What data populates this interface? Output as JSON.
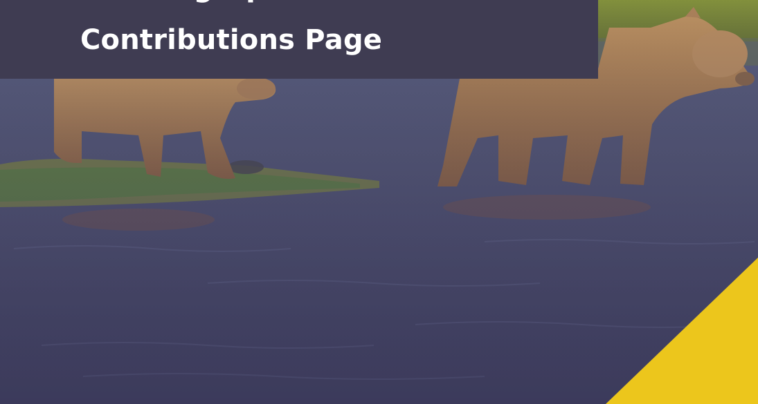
{
  "hero": {
    "image": "brown-bears-wading-in-river-photo",
    "title_lines": [
      "Tracking Up",
      "Contributions Page"
    ]
  },
  "colors": {
    "title_panel_bg": "#3f3c52",
    "title_text": "#ffffff",
    "accent_yellow": "#ecc61c",
    "water": "#4a4c6c"
  }
}
